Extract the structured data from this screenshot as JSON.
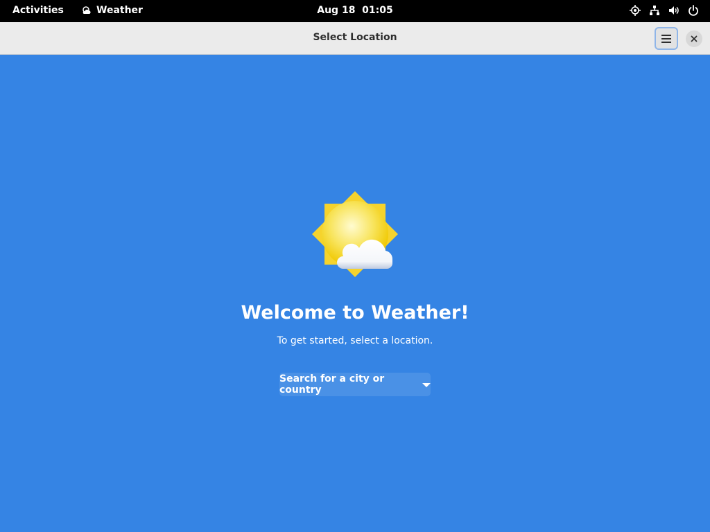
{
  "topbar": {
    "activities_label": "Activities",
    "app_name": "Weather",
    "clock": "Aug 18  01:05",
    "tray_icons": [
      "location-icon",
      "network-icon",
      "volume-icon",
      "power-icon"
    ]
  },
  "headerbar": {
    "title": "Select Location",
    "menu_icon": "hamburger-menu-icon",
    "close_icon": "close-icon"
  },
  "welcome": {
    "title": "Welcome to Weather!",
    "subtitle": "To get started, select a location.",
    "search_label": "Search for a city or country",
    "illustration": "sun-behind-cloud-icon"
  },
  "colors": {
    "background": "#3584e4",
    "topbar": "#000000",
    "headerbar": "#ebebeb",
    "search_button": "#4a91e6"
  }
}
